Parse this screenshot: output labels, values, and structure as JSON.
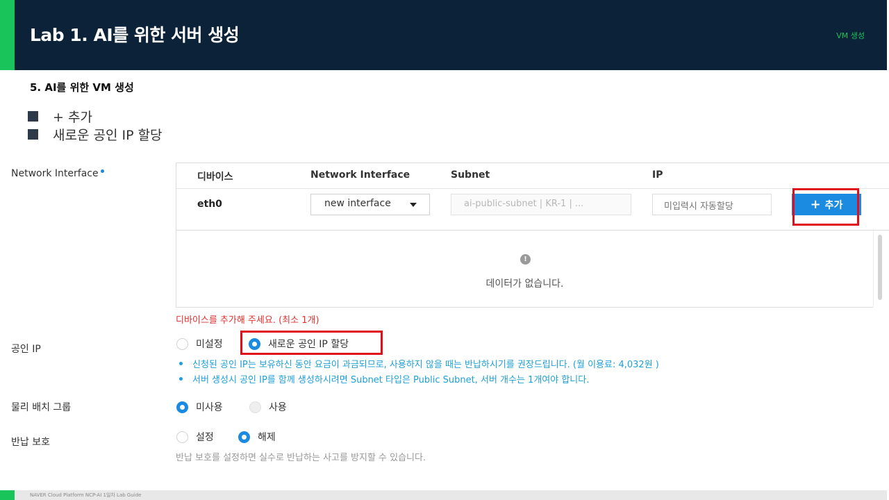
{
  "header": {
    "title": "Lab 1. AI를 위한 서버 생성",
    "tag": "VM 생성"
  },
  "section": {
    "title": "5.  AI를 위한 VM 생성"
  },
  "bullets": [
    "+ 추가",
    "새로운 공인 IP 할당"
  ],
  "network_interface": {
    "label": "Network Interface",
    "columns": [
      "디바이스",
      "Network Interface",
      "Subnet",
      "IP"
    ],
    "row": {
      "device": "eth0",
      "interface_value": "new interface",
      "subnet_value": "ai-public-subnet | KR-1 | ...",
      "ip_placeholder": "미입력시 자동할당",
      "add_button": "추가",
      "add_icon": "plus-icon"
    },
    "empty_text": "데이터가 없습니다.",
    "error_text": "디바이스를 추가해 주세요. (최소 1개)"
  },
  "public_ip": {
    "label": "공인 IP",
    "options": [
      "미설정",
      "새로운 공인 IP 할당"
    ],
    "selected": "새로운 공인 IP 할당",
    "notes": [
      "신청된 공인 IP는 보유하신 동안 요금이 과금되므로, 사용하지 않을 때는 반납하시기를 권장드립니다. (월 이용료: 4,032원 )",
      "서버 생성시 공인 IP를 함께 생성하시려면 Subnet 타입은 Public Subnet, 서버 개수는 1개여야 합니다."
    ]
  },
  "placement_group": {
    "label": "물리 배치 그룹",
    "options": [
      "미사용",
      "사용"
    ],
    "selected": "미사용"
  },
  "termination_protection": {
    "label": "반납 보호",
    "options": [
      "설정",
      "해제"
    ],
    "selected": "해제",
    "help": "반납 보호를 설정하면 실수로 반납하는 사고를 방지할 수 있습니다."
  },
  "footer": {
    "text": "NAVER Cloud Platform  NCP-AI 1일차 Lab Guide"
  },
  "colors": {
    "header_bg": "#0b2238",
    "accent_green": "#19c45a",
    "primary_blue": "#1a8be0",
    "error_red": "#e0312f",
    "highlight_red": "#e0101a"
  }
}
